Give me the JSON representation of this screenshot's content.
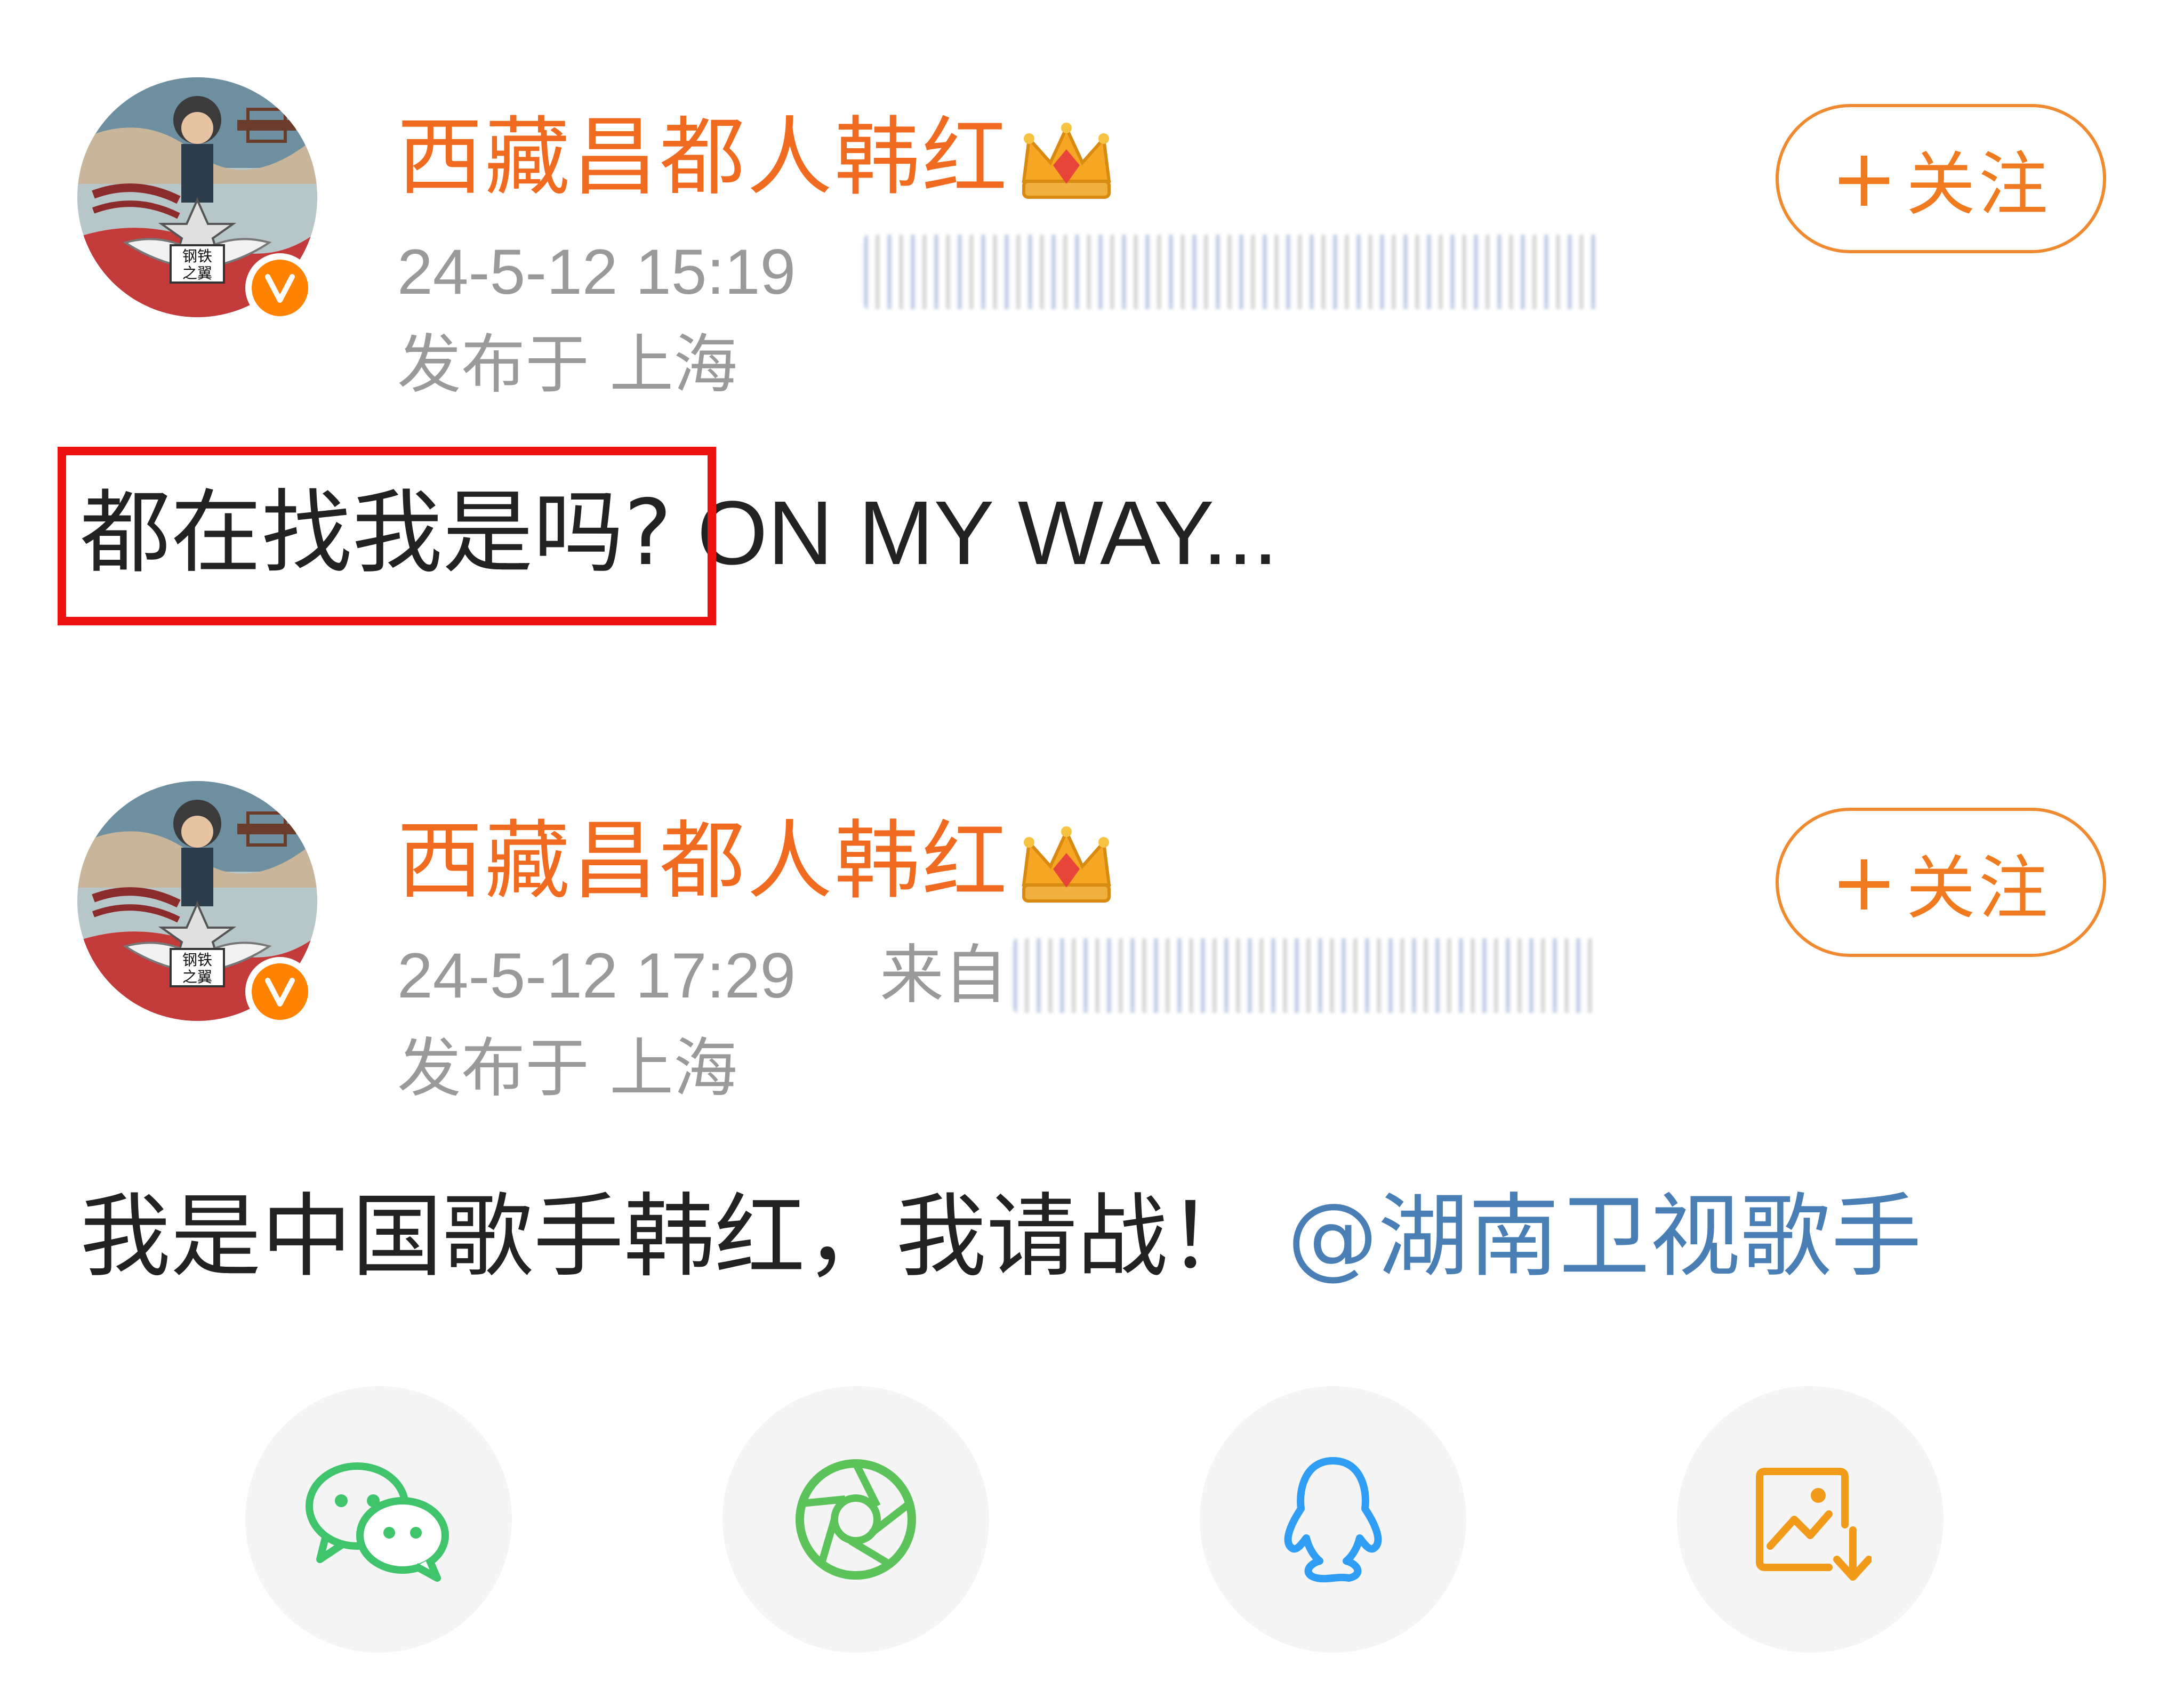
{
  "posts": [
    {
      "user_name": "西藏昌都人韩红",
      "timestamp": "24-5-12 15:19",
      "source_label": "",
      "location": "发布于 上海",
      "follow_label": "关注",
      "follow_plus": "+",
      "text_cn": "都在找我是吗?",
      "text_en": " ON MY WAY...",
      "mention": ""
    },
    {
      "user_name": "西藏昌都人韩红",
      "timestamp": "24-5-12 17:29",
      "source_label": "来自",
      "location": "发布于 上海",
      "follow_label": "关注",
      "follow_plus": "+",
      "text_cn": "我是中国歌手韩红，我请战！",
      "text_en": "",
      "mention": "@湖南卫视歌手"
    }
  ],
  "avatar": {
    "badge_text": "钢铁之翼"
  },
  "share_bar": {
    "items": [
      {
        "icon": "wechat-icon",
        "color": "#3fc46b"
      },
      {
        "icon": "moments-icon",
        "color": "#5cc25a"
      },
      {
        "icon": "qq-icon",
        "color": "#2f9df4"
      },
      {
        "icon": "save-image-icon",
        "color": "#f29b1a"
      }
    ]
  },
  "colors": {
    "username": "#f06b20",
    "follow": "#f07a20",
    "meta": "#9a9a9a",
    "text": "#222222",
    "mention": "#4a7fb5",
    "highlight": "#ee1111",
    "verified": "#ff8200"
  }
}
